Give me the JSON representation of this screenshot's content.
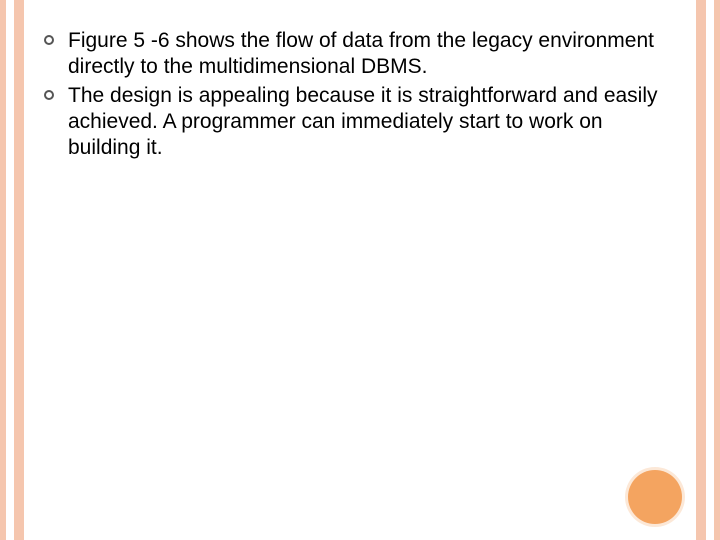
{
  "bullets": [
    {
      "text": "Figure 5 -6 shows the flow of data from the legacy environment directly to the multidimensional DBMS."
    },
    {
      "text": "The design is appealing because it is straightforward and easily achieved. A programmer can immediately start to work on building it."
    }
  ],
  "theme": {
    "stripe_color": "#f5c6ae",
    "accent_circle_color": "#f4a460"
  }
}
